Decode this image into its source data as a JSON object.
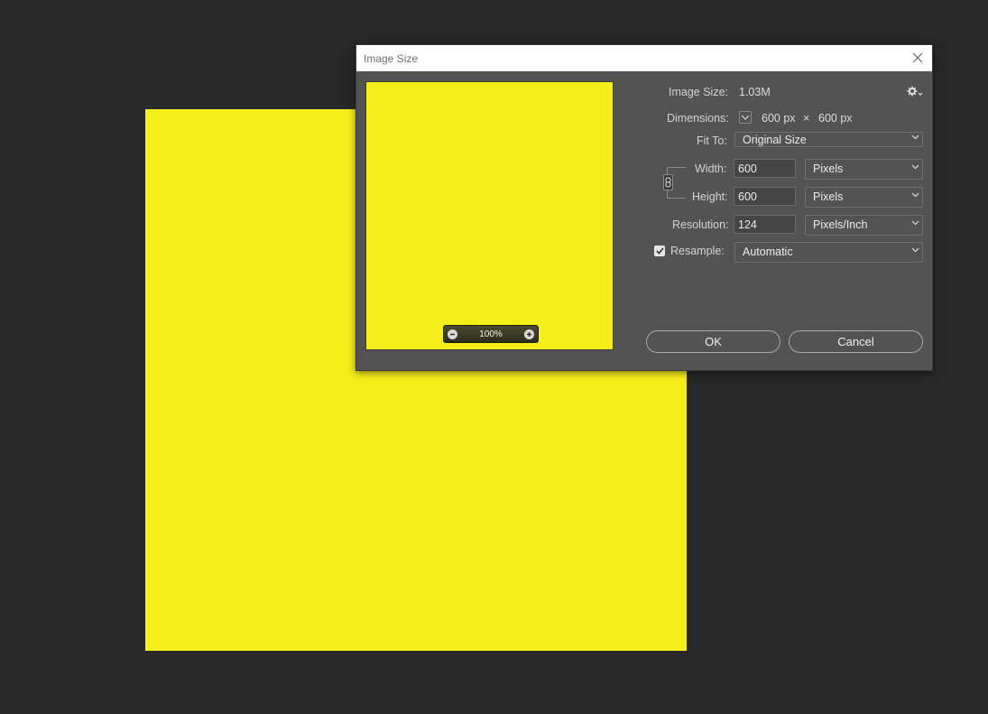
{
  "dialog": {
    "title": "Image Size",
    "image_size_label": "Image Size:",
    "image_size_value": "1.03M",
    "dimensions_label": "Dimensions:",
    "dimensions_width": "600 px",
    "dimensions_times": "×",
    "dimensions_height": "600 px",
    "fit_to_label": "Fit To:",
    "fit_to_value": "Original Size",
    "width_label": "Width:",
    "width_value": "600",
    "width_unit": "Pixels",
    "height_label": "Height:",
    "height_value": "600",
    "height_unit": "Pixels",
    "resolution_label": "Resolution:",
    "resolution_value": "124",
    "resolution_unit": "Pixels/Inch",
    "resample_label": "Resample:",
    "resample_checked": true,
    "resample_value": "Automatic",
    "ok_label": "OK",
    "cancel_label": "Cancel"
  },
  "preview": {
    "zoom": "100%"
  },
  "colors": {
    "image_fill": "#f6ee1a",
    "dialog_bg": "#535353",
    "workspace_bg": "#282828"
  },
  "icons": {
    "close": "close-icon",
    "gear": "gear-icon",
    "chevron": "chevron-down-icon",
    "link": "link-icon",
    "zoom_out": "zoom-out-icon",
    "zoom_in": "zoom-in-icon",
    "check": "checkmark-icon"
  }
}
